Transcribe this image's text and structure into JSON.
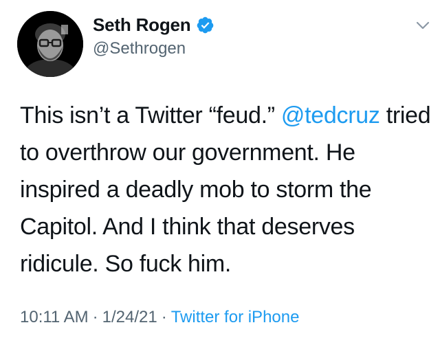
{
  "author": {
    "name": "Seth Rogen",
    "handle": "@Sethrogen",
    "verified": true
  },
  "tweet": {
    "text_before_mention": "This isn’t a Twitter “feud.” ",
    "mention": "@tedcruz",
    "text_after_mention": " tried to overthrow our government. He inspired a deadly mob to storm the Capitol. And I think that deserves ridicule. So fuck him."
  },
  "meta": {
    "time": "10:11 AM",
    "separator": "·",
    "date": "1/24/21",
    "source": "Twitter for iPhone"
  },
  "icons": {
    "verified": "verified-badge-icon",
    "menu": "chevron-down-icon"
  },
  "colors": {
    "accent": "#1d9bf0",
    "text_primary": "#0f1419",
    "text_secondary": "#536471"
  }
}
